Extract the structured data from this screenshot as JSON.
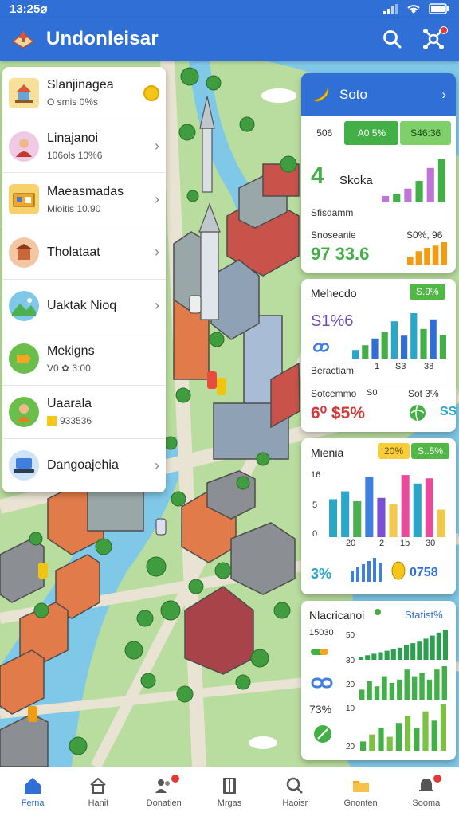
{
  "status": {
    "time": "13:25⌀"
  },
  "app": {
    "title": "Undonleisar"
  },
  "list": [
    {
      "title": "Slanjinagea",
      "sub": "O smis 0%s"
    },
    {
      "title": "Linajanoi",
      "sub": "106ols 10%6"
    },
    {
      "title": "Maeasmadas",
      "sub": "Mioitis 10.90"
    },
    {
      "title": "Tholataat",
      "sub": ""
    },
    {
      "title": "Uaktak Nioq",
      "sub": ""
    },
    {
      "title": "Mekigns",
      "sub": "V0  ✿  3:00"
    },
    {
      "title": "Uaarala",
      "sub": "933536"
    },
    {
      "title": "Dangoajehia",
      "sub": ""
    }
  ],
  "card1": {
    "title": "Soto",
    "tabs": [
      "506",
      "A0 5%",
      "S46:36"
    ],
    "big_number": "4",
    "label1": "Skoka",
    "label2": "Sfisdamm",
    "label3": "Snoseanie",
    "label4": "S0%, 96",
    "big_value": "97 33.6",
    "bars_purple": [
      0.15,
      0.2,
      0.32,
      0.5,
      0.8,
      1.0
    ],
    "bars_orange": [
      0.35,
      0.6,
      0.75,
      0.85,
      1.0
    ]
  },
  "card2": {
    "title": "Mehecdo",
    "pill": "S.9%",
    "pct": "S1%6",
    "label1": "Beractiam",
    "ticks": [
      "1",
      "S3",
      "38"
    ],
    "label2": "Sotcemmo",
    "label3": "S0",
    "label4": "Sot 3%",
    "label5": "SS",
    "value1": "6⁰ $5%",
    "bars": [
      0.18,
      0.28,
      0.42,
      0.55,
      0.78,
      0.48,
      0.95,
      0.62,
      0.82,
      0.5
    ]
  },
  "card3": {
    "title": "Mienia",
    "pill1": "20%",
    "pill2": "S..5%",
    "yticks": [
      "16",
      "5",
      "0"
    ],
    "xticks": [
      "20",
      "2",
      "1b",
      "30"
    ],
    "pct": "3%",
    "value": "0758",
    "bars": [
      {
        "v": 0.58,
        "c": "#2aa6c9"
      },
      {
        "v": 0.7,
        "c": "#2aa6c9"
      },
      {
        "v": 0.55,
        "c": "#4caf50"
      },
      {
        "v": 0.92,
        "c": "#3f7fe0"
      },
      {
        "v": 0.6,
        "c": "#7a4fd6"
      },
      {
        "v": 0.5,
        "c": "#f2c94c"
      },
      {
        "v": 0.95,
        "c": "#e94b9b"
      },
      {
        "v": 0.82,
        "c": "#2aa6c9"
      },
      {
        "v": 0.9,
        "c": "#e94b9b"
      },
      {
        "v": 0.42,
        "c": "#f2c94c"
      }
    ]
  },
  "card4": {
    "title": "Nlacricanoi",
    "stat": "Statist%",
    "ticks": [
      "15030",
      "50",
      "30",
      "20",
      "10",
      "20"
    ],
    "value": "73%",
    "bars_top": [
      0.1,
      0.15,
      0.2,
      0.25,
      0.3,
      0.35,
      0.4,
      0.5,
      0.55,
      0.6,
      0.7,
      0.8,
      0.9,
      1.0
    ],
    "bars_mid": [
      0.3,
      0.55,
      0.4,
      0.7,
      0.5,
      0.6,
      0.9,
      0.7,
      0.8,
      0.6,
      0.9,
      1.0
    ],
    "bars_bot": [
      0.2,
      0.35,
      0.5,
      0.3,
      0.6,
      0.75,
      0.5,
      0.85,
      0.65,
      1.0
    ]
  },
  "nav": [
    {
      "label": "Ferna",
      "icon": "home-icon",
      "active": true,
      "badge": false
    },
    {
      "label": "Hanit",
      "icon": "house-icon",
      "active": false,
      "badge": false
    },
    {
      "label": "Donatien",
      "icon": "people-icon",
      "active": false,
      "badge": true
    },
    {
      "label": "Mrgas",
      "icon": "book-icon",
      "active": false,
      "badge": false
    },
    {
      "label": "Haoisr",
      "icon": "search-icon",
      "active": false,
      "badge": false
    },
    {
      "label": "Gnonten",
      "icon": "folder-icon",
      "active": false,
      "badge": false
    },
    {
      "label": "Sooma",
      "icon": "bell-icon",
      "active": false,
      "badge": true
    }
  ],
  "colors": {
    "primary": "#2f6fd6",
    "green": "#43b047",
    "water": "#7fc8e8",
    "grass": "#a9d98a"
  }
}
